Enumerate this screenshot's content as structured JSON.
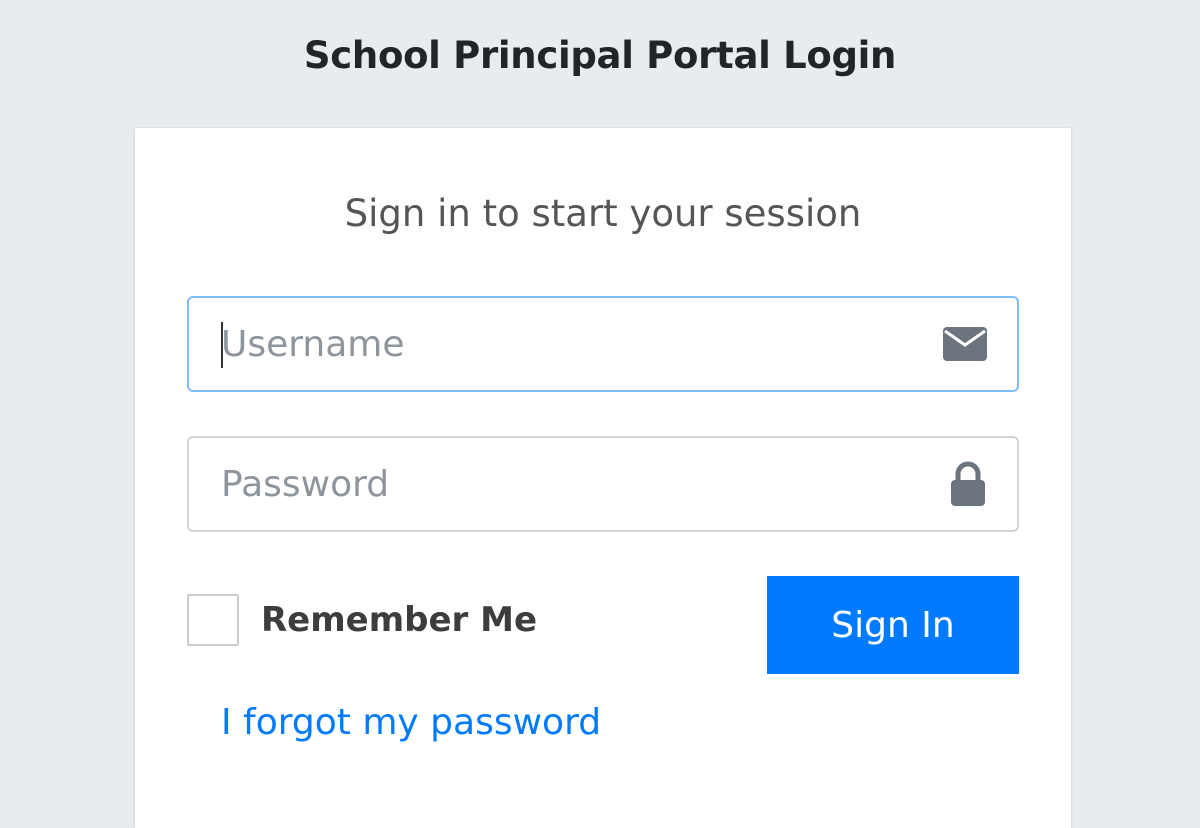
{
  "page": {
    "title": "School Principal Portal Login"
  },
  "login_box": {
    "message": "Sign in to start your session",
    "username": {
      "placeholder": "Username",
      "value": "",
      "icon": "envelope-icon"
    },
    "password": {
      "placeholder": "Password",
      "value": "",
      "icon": "lock-icon"
    },
    "remember": {
      "label": "Remember Me",
      "checked": false
    },
    "submit_label": "Sign In",
    "forgot_link": "I forgot my password"
  },
  "colors": {
    "background": "#e9ecef",
    "primary": "#007bff",
    "focus_border": "#80bdff",
    "icon": "#6c757d"
  }
}
